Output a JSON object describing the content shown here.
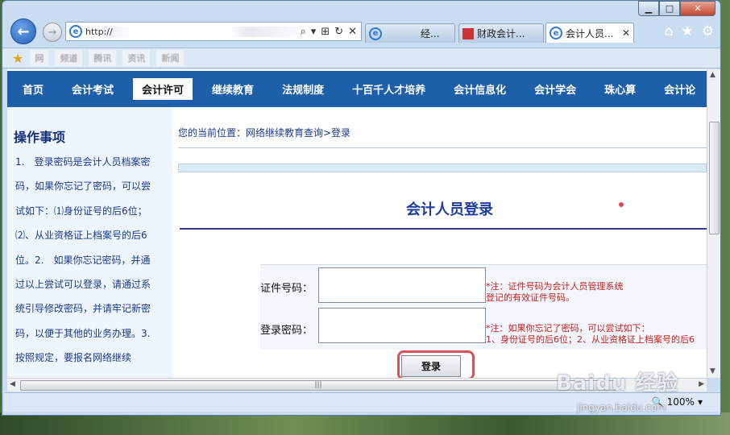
{
  "window": {
    "caption_min": "▁",
    "caption_max": "□",
    "caption_close": "✕"
  },
  "browser": {
    "back_glyph": "←",
    "forward_glyph": "→",
    "address_text": "http://",
    "address_suffix": "/e",
    "address_tools": [
      "⌕",
      "▾",
      "⊞",
      "↻",
      "✕"
    ],
    "tabs": [
      {
        "label": "经...",
        "icon": "ie-icon"
      },
      {
        "label": "财政会计...",
        "icon": "page-icon"
      },
      {
        "label": "会计人员...",
        "icon": "ie-icon",
        "close": "✕"
      }
    ],
    "right_icons": [
      "⌂",
      "★",
      "⚙"
    ],
    "favorites": [
      "网",
      "频道",
      "腾讯",
      "资讯",
      "新闻"
    ],
    "zoom": "100%",
    "zoom_arrow": "▾"
  },
  "nav": {
    "items": [
      "首页",
      "会计考试",
      "会计许可",
      "继续教育",
      "法规制度",
      "十百千人才培养",
      "会计信息化",
      "会计学会",
      "珠心算",
      "会计论"
    ],
    "active_index": 2
  },
  "sidebar": {
    "title": "操作事项",
    "text": "1.　登录密码是会计人员档案密码，如果你忘记了密码，可以尝试如下：⑴身份证号的后6位；⑵、从业资格证上档案号的后6位。2.　如果你忘记密码，并通过以上尝试可以登录，请通过系统引导修改密码，并请牢记新密码，以便于其他的业务办理。3.　按照规定，要报名网络继续"
  },
  "breadcrumb": "您的当前位置：网络继续教育查询>登录",
  "login": {
    "title": "会计人员登录",
    "id_label": "证件号码：",
    "id_value": "",
    "id_note_1": "*注：证件号码为会计人员管理系统",
    "id_note_2": "登记的有效证件号码。",
    "pwd_label": "登录密码：",
    "pwd_value": "",
    "pwd_note_1": "*注：如果你忘记了密码，可以尝试如下：",
    "pwd_note_2": "1、身份证号的后6位；2、从业资格证上档案号的后6",
    "button": "登录"
  },
  "watermark": {
    "brand": "Baidu 经验",
    "url": "jingyan.baidu.com"
  },
  "colors": {
    "nav_bg": "#1d5fa8",
    "title_blue": "#1f3b9c",
    "note_red": "#c81d1d",
    "highlight_red": "#d9525a"
  }
}
